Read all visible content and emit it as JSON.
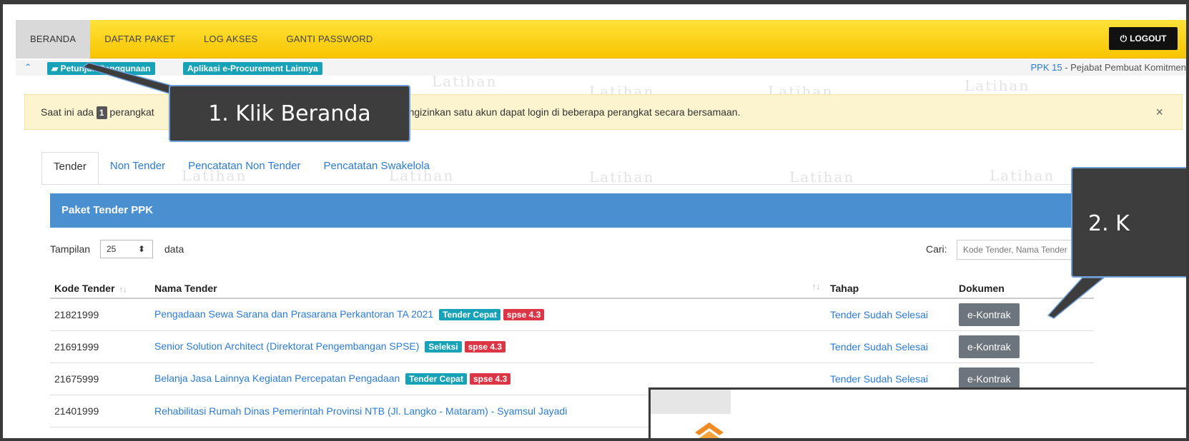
{
  "nav": {
    "items": [
      "BERANDA",
      "DAFTAR PAKET",
      "LOG AKSES",
      "GANTI PASSWORD"
    ],
    "logout_label": "LOGOUT"
  },
  "breadcrumb": {
    "help_label": "Petunjuk Penggunaan",
    "apps_label": "Aplikasi e-Procurement Lainnya",
    "role_code": "PPK 15",
    "role_label": " - Pejabat Pembuat Komitmen"
  },
  "alert": {
    "prefix": "Saat ini ada",
    "count": "1",
    "middle": "perangkat",
    "suffix": "SE mengizinkan satu akun dapat login di beberapa perangkat secara bersamaan.",
    "close": "×"
  },
  "watermark": "Latihan",
  "tabs": [
    "Tender",
    "Non Tender",
    "Pencatatan Non Tender",
    "Pencatatan Swakelola"
  ],
  "panel": {
    "title": "Paket Tender PPK",
    "show_label": "Tampilan",
    "page_size": "25",
    "data_label": "data",
    "search_label": "Cari:",
    "search_placeholder": "Kode Tender, Nama Tender"
  },
  "table": {
    "headers": [
      "Kode Tender",
      "Nama Tender",
      "Tahap",
      "Dokumen"
    ],
    "rows": [
      {
        "kode": "21821999",
        "nama": "Pengadaan Sewa Sarana dan Prasarana Perkantoran TA 2021",
        "tag1": "Tender Cepat",
        "tag2": "spse 4.3",
        "tahap": "Tender Sudah Selesai",
        "dokumen": "e-Kontrak"
      },
      {
        "kode": "21691999",
        "nama": "Senior Solution Architect (Direktorat Pengembangan SPSE)",
        "tag1": "Seleksi",
        "tag2": "spse 4.3",
        "tahap": "Tender Sudah Selesai",
        "dokumen": "e-Kontrak"
      },
      {
        "kode": "21675999",
        "nama": "Belanja Jasa Lainnya Kegiatan Percepatan Pengadaan",
        "tag1": "Tender Cepat",
        "tag2": "spse 4.3",
        "tahap": "Tender Sudah Selesai",
        "dokumen": "e-Kontrak"
      },
      {
        "kode": "21401999",
        "nama": "Rehabilitasi Rumah Dinas Pemerintah Provinsi NTB (Jl. Langko - Mataram) - Syamsul Jayadi",
        "tag1": "",
        "tag2": "",
        "tahap": "",
        "dokumen": ""
      }
    ]
  },
  "callouts": {
    "step1": "1. Klik Beranda",
    "step2": "2. K"
  },
  "colors": {
    "nav_yellow": "#f7c400",
    "panel_blue": "#4a8fcf",
    "link_blue": "#2a7bd6",
    "tag_info": "#17a2b8",
    "tag_danger": "#dc3545",
    "callout_bg": "#3d3d3d"
  }
}
